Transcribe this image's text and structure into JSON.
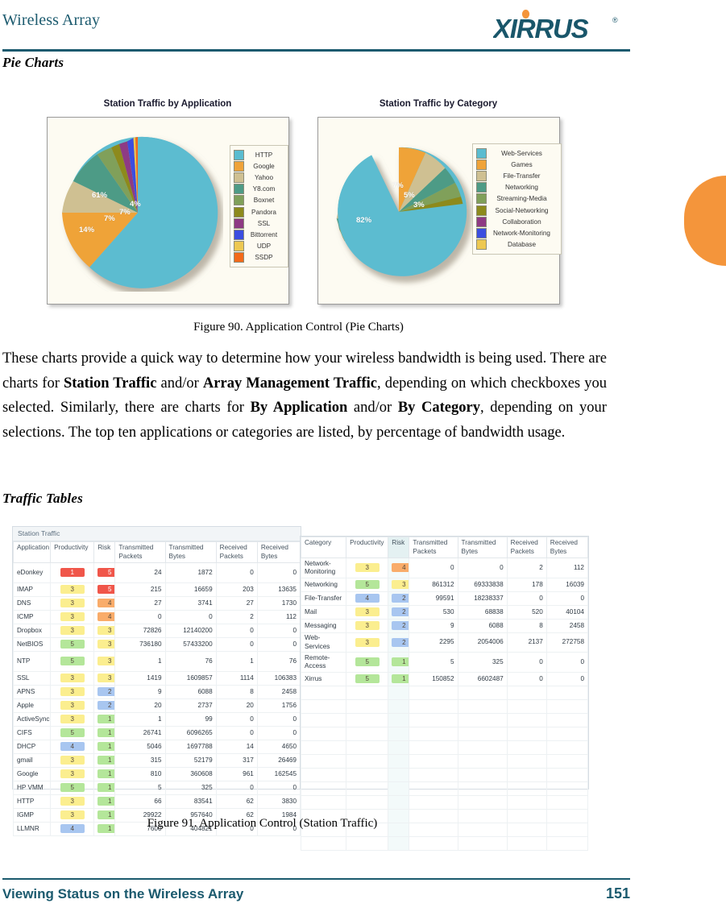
{
  "header": {
    "title": "Wireless Array",
    "logo_text": "XIRRUS",
    "logo_tm": "®"
  },
  "sections": {
    "pie_charts_heading": "Pie Charts",
    "traffic_tables_heading": "Traffic Tables"
  },
  "figures": {
    "fig90": "Figure 90. Application Control (Pie Charts)",
    "fig91": "Figure 91. Application Control (Station Traffic)"
  },
  "body": {
    "p1_a": "These charts provide a quick way to determine how your wireless bandwidth is being used. There are charts for ",
    "p1_b1": "Station Traffic",
    "p1_c": " and/or ",
    "p1_b2": "Array Management Traffic",
    "p1_d": ", depending on which checkboxes you selected. Similarly, there are charts for ",
    "p1_b3": "By Application",
    "p1_e": " and/or ",
    "p1_b4": "By Category",
    "p1_f": ", depending on your selections. The top ten applications or categories are listed, by percentage of bandwidth usage."
  },
  "colors": {
    "brand_teal": "#1b5a6e",
    "accent_orange": "#f4953b",
    "pie_panel_bg": "#fdfbf2"
  },
  "chart_data": [
    {
      "type": "pie",
      "title": "Station Traffic by Application",
      "legend_position": "right",
      "categories": [
        "HTTP",
        "Google",
        "Yahoo",
        "Y8.com",
        "Boxnet",
        "Pandora",
        "SSL",
        "Bittorrent",
        "UDP",
        "SSDP"
      ],
      "values": [
        61,
        14,
        7,
        7,
        4,
        2,
        2,
        1.5,
        1,
        0.5
      ],
      "labels_shown": [
        "61%",
        "14%",
        "7%",
        "7%",
        "4%"
      ],
      "colors": [
        "#5bbcd0",
        "#efa339",
        "#cfc092",
        "#4e9b86",
        "#80a05a",
        "#8d8a1c",
        "#8e3a84",
        "#3b4ee0",
        "#edc852",
        "#f36a1a"
      ]
    },
    {
      "type": "pie",
      "title": "Station Traffic by Category",
      "legend_position": "right",
      "categories": [
        "Web-Services",
        "Games",
        "File-Transfer",
        "Networking",
        "Streaming-Media",
        "Social-Networking",
        "Collaboration",
        "Network-Monitoring",
        "Database"
      ],
      "values": [
        82,
        7,
        5,
        3,
        2,
        1,
        0,
        0,
        0
      ],
      "labels_shown": [
        "82%",
        "7%",
        "5%",
        "3%"
      ],
      "colors": [
        "#5bbcd0",
        "#efa339",
        "#cfc092",
        "#4e9b86",
        "#80a05a",
        "#8d8a1c",
        "#8e3a84",
        "#3b4ee0",
        "#edc852"
      ]
    }
  ],
  "station_traffic_table": {
    "caption": "Station Traffic",
    "columns": [
      "Application",
      "Productivity",
      "Risk",
      "Transmitted Packets",
      "Transmitted Bytes",
      "Received Packets",
      "Received Bytes"
    ],
    "highlight_column": null,
    "rows": [
      {
        "name": "eDonkey",
        "productivity": "1",
        "p_class": "c1",
        "risk": "5",
        "r_class": "c1",
        "tx_pkts": "24",
        "tx_bytes": "1872",
        "rx_pkts": "0",
        "rx_bytes": "0",
        "tall": true
      },
      {
        "name": "IMAP",
        "productivity": "3",
        "p_class": "c3",
        "risk": "5",
        "r_class": "c1",
        "tx_pkts": "215",
        "tx_bytes": "16659",
        "rx_pkts": "203",
        "rx_bytes": "13635"
      },
      {
        "name": "DNS",
        "productivity": "3",
        "p_class": "c3",
        "risk": "4",
        "r_class": "c2",
        "tx_pkts": "27",
        "tx_bytes": "3741",
        "rx_pkts": "27",
        "rx_bytes": "1730"
      },
      {
        "name": "ICMP",
        "productivity": "3",
        "p_class": "c3",
        "risk": "4",
        "r_class": "c2",
        "tx_pkts": "0",
        "tx_bytes": "0",
        "rx_pkts": "2",
        "rx_bytes": "112"
      },
      {
        "name": "Dropbox",
        "productivity": "3",
        "p_class": "c3",
        "risk": "3",
        "r_class": "c3",
        "tx_pkts": "72826",
        "tx_bytes": "12140200",
        "rx_pkts": "0",
        "rx_bytes": "0"
      },
      {
        "name": "NetBIOS",
        "productivity": "5",
        "p_class": "c5",
        "risk": "3",
        "r_class": "c3",
        "tx_pkts": "736180",
        "tx_bytes": "57433200",
        "rx_pkts": "0",
        "rx_bytes": "0"
      },
      {
        "name": "NTP",
        "productivity": "5",
        "p_class": "c5",
        "risk": "3",
        "r_class": "c3",
        "tx_pkts": "1",
        "tx_bytes": "76",
        "rx_pkts": "1",
        "rx_bytes": "76",
        "tall": true
      },
      {
        "name": "SSL",
        "productivity": "3",
        "p_class": "c3",
        "risk": "3",
        "r_class": "c3",
        "tx_pkts": "1419",
        "tx_bytes": "1609857",
        "rx_pkts": "1114",
        "rx_bytes": "106383"
      },
      {
        "name": "APNS",
        "productivity": "3",
        "p_class": "c3",
        "risk": "2",
        "r_class": "c4",
        "tx_pkts": "9",
        "tx_bytes": "6088",
        "rx_pkts": "8",
        "rx_bytes": "2458"
      },
      {
        "name": "Apple",
        "productivity": "3",
        "p_class": "c3",
        "risk": "2",
        "r_class": "c4",
        "tx_pkts": "20",
        "tx_bytes": "2737",
        "rx_pkts": "20",
        "rx_bytes": "1756"
      },
      {
        "name": "ActiveSync",
        "productivity": "3",
        "p_class": "c3",
        "risk": "1",
        "r_class": "c5",
        "tx_pkts": "1",
        "tx_bytes": "99",
        "rx_pkts": "0",
        "rx_bytes": "0"
      },
      {
        "name": "CIFS",
        "productivity": "5",
        "p_class": "c5",
        "risk": "1",
        "r_class": "c5",
        "tx_pkts": "26741",
        "tx_bytes": "6096265",
        "rx_pkts": "0",
        "rx_bytes": "0"
      },
      {
        "name": "DHCP",
        "productivity": "4",
        "p_class": "c4",
        "risk": "1",
        "r_class": "c5",
        "tx_pkts": "5046",
        "tx_bytes": "1697788",
        "rx_pkts": "14",
        "rx_bytes": "4650"
      },
      {
        "name": "gmail",
        "productivity": "3",
        "p_class": "c3",
        "risk": "1",
        "r_class": "c5",
        "tx_pkts": "315",
        "tx_bytes": "52179",
        "rx_pkts": "317",
        "rx_bytes": "26469"
      },
      {
        "name": "Google",
        "productivity": "3",
        "p_class": "c3",
        "risk": "1",
        "r_class": "c5",
        "tx_pkts": "810",
        "tx_bytes": "360608",
        "rx_pkts": "961",
        "rx_bytes": "162545"
      },
      {
        "name": "HP VMM",
        "productivity": "5",
        "p_class": "c5",
        "risk": "1",
        "r_class": "c5",
        "tx_pkts": "5",
        "tx_bytes": "325",
        "rx_pkts": "0",
        "rx_bytes": "0"
      },
      {
        "name": "HTTP",
        "productivity": "3",
        "p_class": "c3",
        "risk": "1",
        "r_class": "c5",
        "tx_pkts": "66",
        "tx_bytes": "83541",
        "rx_pkts": "62",
        "rx_bytes": "3830"
      },
      {
        "name": "IGMP",
        "productivity": "3",
        "p_class": "c3",
        "risk": "1",
        "r_class": "c5",
        "tx_pkts": "29922",
        "tx_bytes": "957640",
        "rx_pkts": "62",
        "rx_bytes": "1984"
      },
      {
        "name": "LLMNR",
        "productivity": "4",
        "p_class": "c4",
        "risk": "1",
        "r_class": "c5",
        "tx_pkts": "7600",
        "tx_bytes": "404821",
        "rx_pkts": "0",
        "rx_bytes": "0"
      }
    ]
  },
  "category_traffic_table": {
    "caption": "",
    "columns": [
      "Category",
      "Productivity",
      "Risk",
      "Transmitted Packets",
      "Transmitted Bytes",
      "Received Packets",
      "Received Bytes"
    ],
    "highlight_column": "Risk",
    "rows": [
      {
        "name": "Network-Monitoring",
        "productivity": "3",
        "p_class": "c3",
        "risk": "4",
        "r_class": "c2",
        "tx_pkts": "0",
        "tx_bytes": "0",
        "rx_pkts": "2",
        "rx_bytes": "112",
        "tall": true
      },
      {
        "name": "Networking",
        "productivity": "5",
        "p_class": "c5",
        "risk": "3",
        "r_class": "c3",
        "tx_pkts": "861312",
        "tx_bytes": "69333838",
        "rx_pkts": "178",
        "rx_bytes": "16039"
      },
      {
        "name": "File-Transfer",
        "productivity": "4",
        "p_class": "c4",
        "risk": "2",
        "r_class": "c4",
        "tx_pkts": "99591",
        "tx_bytes": "18238337",
        "rx_pkts": "0",
        "rx_bytes": "0"
      },
      {
        "name": "Mail",
        "productivity": "3",
        "p_class": "c3",
        "risk": "2",
        "r_class": "c4",
        "tx_pkts": "530",
        "tx_bytes": "68838",
        "rx_pkts": "520",
        "rx_bytes": "40104"
      },
      {
        "name": "Messaging",
        "productivity": "3",
        "p_class": "c3",
        "risk": "2",
        "r_class": "c4",
        "tx_pkts": "9",
        "tx_bytes": "6088",
        "rx_pkts": "8",
        "rx_bytes": "2458"
      },
      {
        "name": "Web-Services",
        "productivity": "3",
        "p_class": "c3",
        "risk": "2",
        "r_class": "c4",
        "tx_pkts": "2295",
        "tx_bytes": "2054006",
        "rx_pkts": "2137",
        "rx_bytes": "272758"
      },
      {
        "name": "Remote-Access",
        "productivity": "5",
        "p_class": "c5",
        "risk": "1",
        "r_class": "c5",
        "tx_pkts": "5",
        "tx_bytes": "325",
        "rx_pkts": "0",
        "rx_bytes": "0",
        "tall": true
      },
      {
        "name": "Xirrus",
        "productivity": "5",
        "p_class": "c5",
        "risk": "1",
        "r_class": "c5",
        "tx_pkts": "150852",
        "tx_bytes": "6602487",
        "rx_pkts": "0",
        "rx_bytes": "0"
      }
    ],
    "empty_rows": 12
  },
  "footer": {
    "left": "Viewing Status on the Wireless Array",
    "page_number": "151"
  }
}
